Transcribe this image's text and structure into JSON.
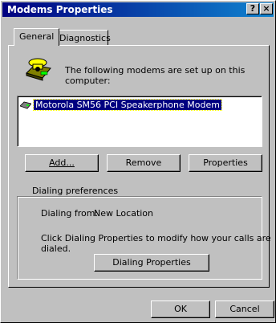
{
  "window": {
    "title": "Modems Properties",
    "help_button": "?",
    "close_button": "×"
  },
  "tabs": [
    {
      "label": "General",
      "active": true
    },
    {
      "label": "Diagnostics",
      "active": false
    }
  ],
  "general": {
    "intro_text": "The following modems are set up on this computer:",
    "modems": [
      {
        "name": "Motorola SM56 PCI Speakerphone Modem",
        "selected": true
      }
    ],
    "buttons": {
      "add": "Add...",
      "remove": "Remove",
      "properties": "Properties"
    },
    "dialing_preferences": {
      "group_label": "Dialing preferences",
      "dialing_from_label": "Dialing from:",
      "dialing_from_value": "New Location",
      "hint_line1": "Click Dialing Properties to modify how your calls are",
      "hint_line2": "dialed.",
      "button": "Dialing Properties"
    }
  },
  "footer": {
    "ok": "OK",
    "cancel": "Cancel"
  },
  "icons": {
    "modem": "telephone-modem-icon",
    "list_item": "modem-device-icon"
  }
}
